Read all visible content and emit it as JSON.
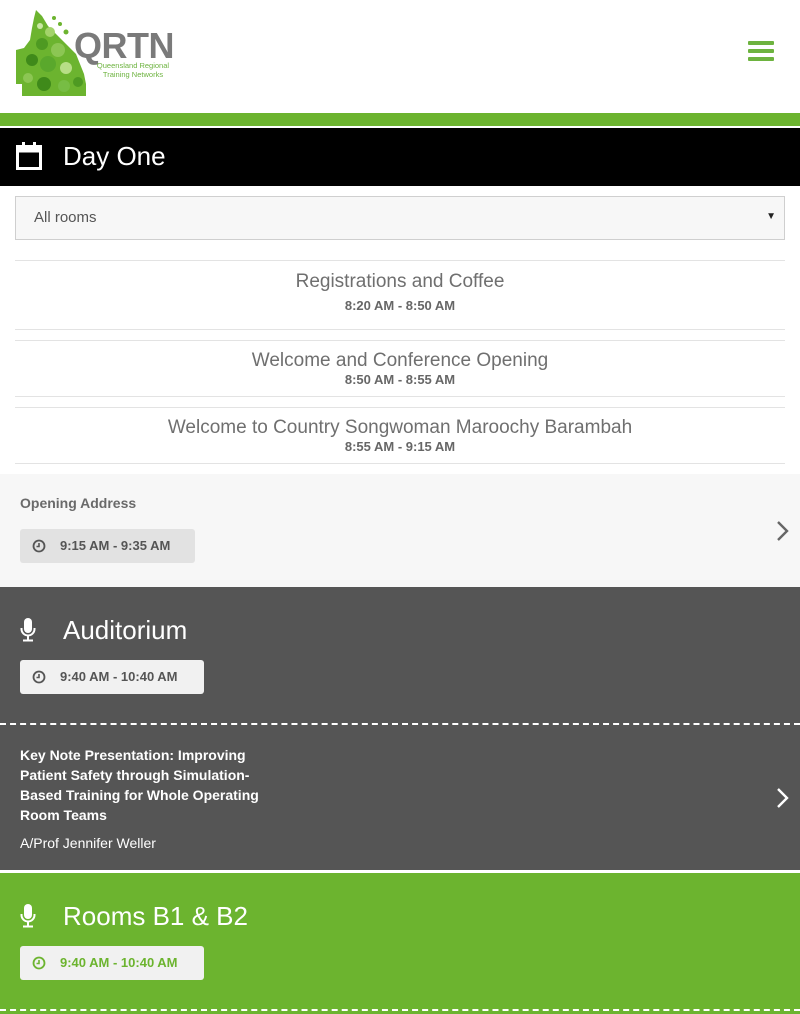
{
  "header": {
    "logo_text": "QRTN",
    "logo_subtitle": "Queensland Regional Training Networks",
    "menu_icon": "hamburger-icon",
    "accent_color": "#6cb42f"
  },
  "day": {
    "title": "Day One",
    "icon": "calendar-icon"
  },
  "room_filter": {
    "selected": "All rooms"
  },
  "sessions": [
    {
      "title": "Registrations and Coffee",
      "time": "8:20 AM - 8:50 AM"
    },
    {
      "title": "Welcome and Conference Opening",
      "time": "8:50 AM - 8:55 AM"
    },
    {
      "title": "Welcome to Country Songwoman Maroochy Barambah",
      "time": "8:55 AM - 9:15 AM"
    }
  ],
  "opening": {
    "title": "Opening Address",
    "time": "9:15 AM - 9:35 AM"
  },
  "auditorium": {
    "room": "Auditorium",
    "time": "9:40 AM - 10:40 AM",
    "talk_title": "Key Note Presentation: Improving Patient Safety through Simulation-Based Training for Whole Operating Room Teams",
    "speaker": "A/Prof Jennifer Weller",
    "background": "#555555"
  },
  "rooms_b": {
    "room": "Rooms B1 & B2",
    "time": "9:40 AM - 10:40 AM",
    "background": "#6cb42f"
  }
}
